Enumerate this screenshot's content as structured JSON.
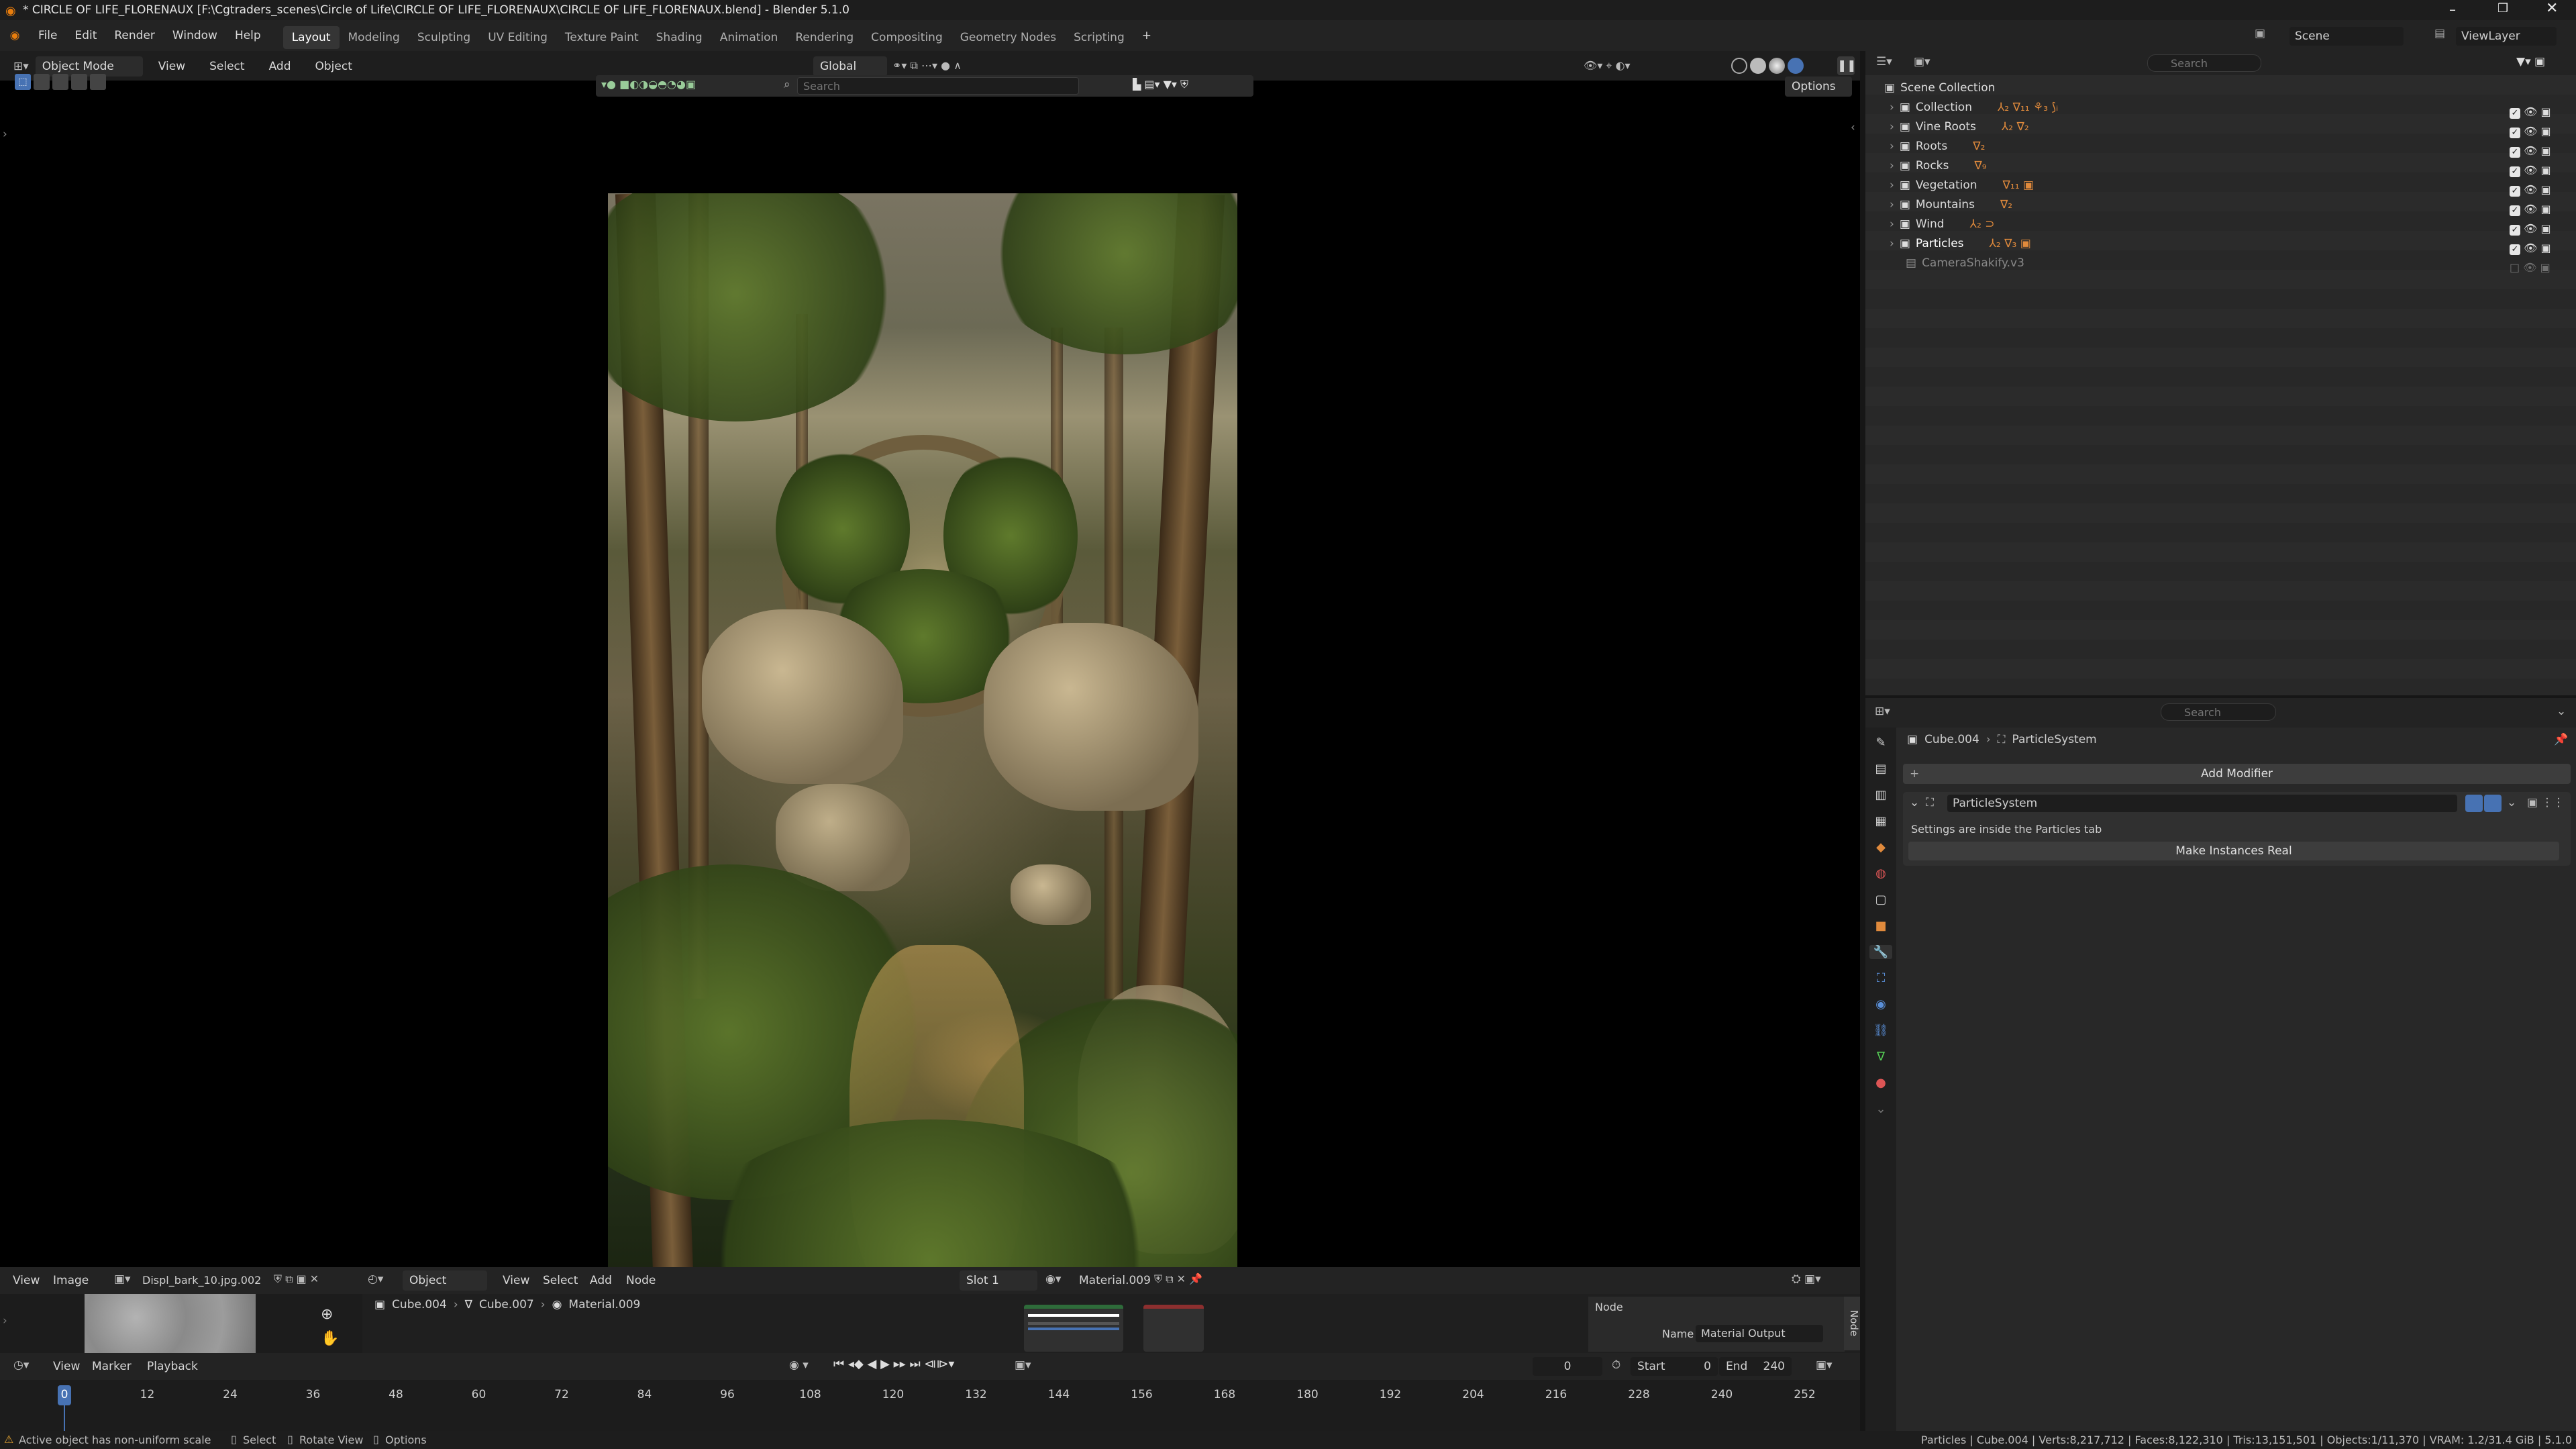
{
  "window": {
    "title": "* CIRCLE OF LIFE_FLORENAUX [F:\\Cgtraders_scenes\\Circle of Life\\CIRCLE OF LIFE_FLORENAUX\\CIRCLE OF LIFE_FLORENAUX.blend] - Blender 5.1.0"
  },
  "menu": [
    "File",
    "Edit",
    "Render",
    "Window",
    "Help"
  ],
  "workspaces": [
    "Layout",
    "Modeling",
    "Sculpting",
    "UV Editing",
    "Texture Paint",
    "Shading",
    "Animation",
    "Rendering",
    "Compositing",
    "Geometry Nodes",
    "Scripting"
  ],
  "active_workspace": "Layout",
  "scene": {
    "label": "Scene",
    "view_layer": "ViewLayer"
  },
  "viewport_header": {
    "mode": "Object Mode",
    "menus": [
      "View",
      "Select",
      "Add",
      "Object"
    ],
    "transform": "Global",
    "search_placeholder": "Search",
    "options": "Options"
  },
  "outliner": {
    "search_placeholder": "Search",
    "root": "Scene Collection",
    "items": [
      "Collection",
      "Vine Roots",
      "Roots",
      "Rocks",
      "Vegetation",
      "Mountains",
      "Wind",
      "Particles",
      "CameraShakify.v3"
    ]
  },
  "properties": {
    "search_placeholder": "Search",
    "breadcrumb": {
      "object": "Cube.004",
      "modifier": "ParticleSystem"
    },
    "add_modifier": "Add Modifier",
    "modifier_name": "ParticleSystem",
    "info": "Settings are inside the Particles tab",
    "make_instances_real": "Make Instances Real"
  },
  "image_editor": {
    "menus": [
      "View",
      "Image"
    ],
    "image_name": "Displ_bark_10.jpg.002"
  },
  "shader_editor": {
    "type": "Object",
    "menus": [
      "View",
      "Select",
      "Add",
      "Node"
    ],
    "slot": "Slot 1",
    "material": "Material.009",
    "breadcrumb": [
      "Cube.004",
      "Cube.007",
      "Material.009"
    ],
    "node_panel": {
      "title": "Node",
      "name_label": "Name",
      "name_value": "Material Output",
      "tab": "Node"
    }
  },
  "timeline": {
    "menus": [
      "View",
      "Marker",
      "Playback"
    ],
    "current_frame": "0",
    "start_label": "Start",
    "start": "0",
    "end_label": "End",
    "end": "240",
    "ticks": [
      "0",
      "12",
      "24",
      "36",
      "48",
      "60",
      "72",
      "84",
      "96",
      "108",
      "120",
      "132",
      "144",
      "156",
      "168",
      "180",
      "192",
      "204",
      "216",
      "228",
      "240",
      "252"
    ]
  },
  "status": {
    "warning": "Active object has non-uniform scale",
    "select": "Select",
    "rotate": "Rotate View",
    "options": "Options",
    "stats": "Particles | Cube.004 | Verts:8,217,712 | Faces:8,122,310 | Tris:13,151,501 | Objects:1/11,370 | VRAM: 1.2/31.4 GiB | 5.1.0"
  },
  "colors": {
    "accent": "#4772b3",
    "orange": "#e08a3c"
  }
}
